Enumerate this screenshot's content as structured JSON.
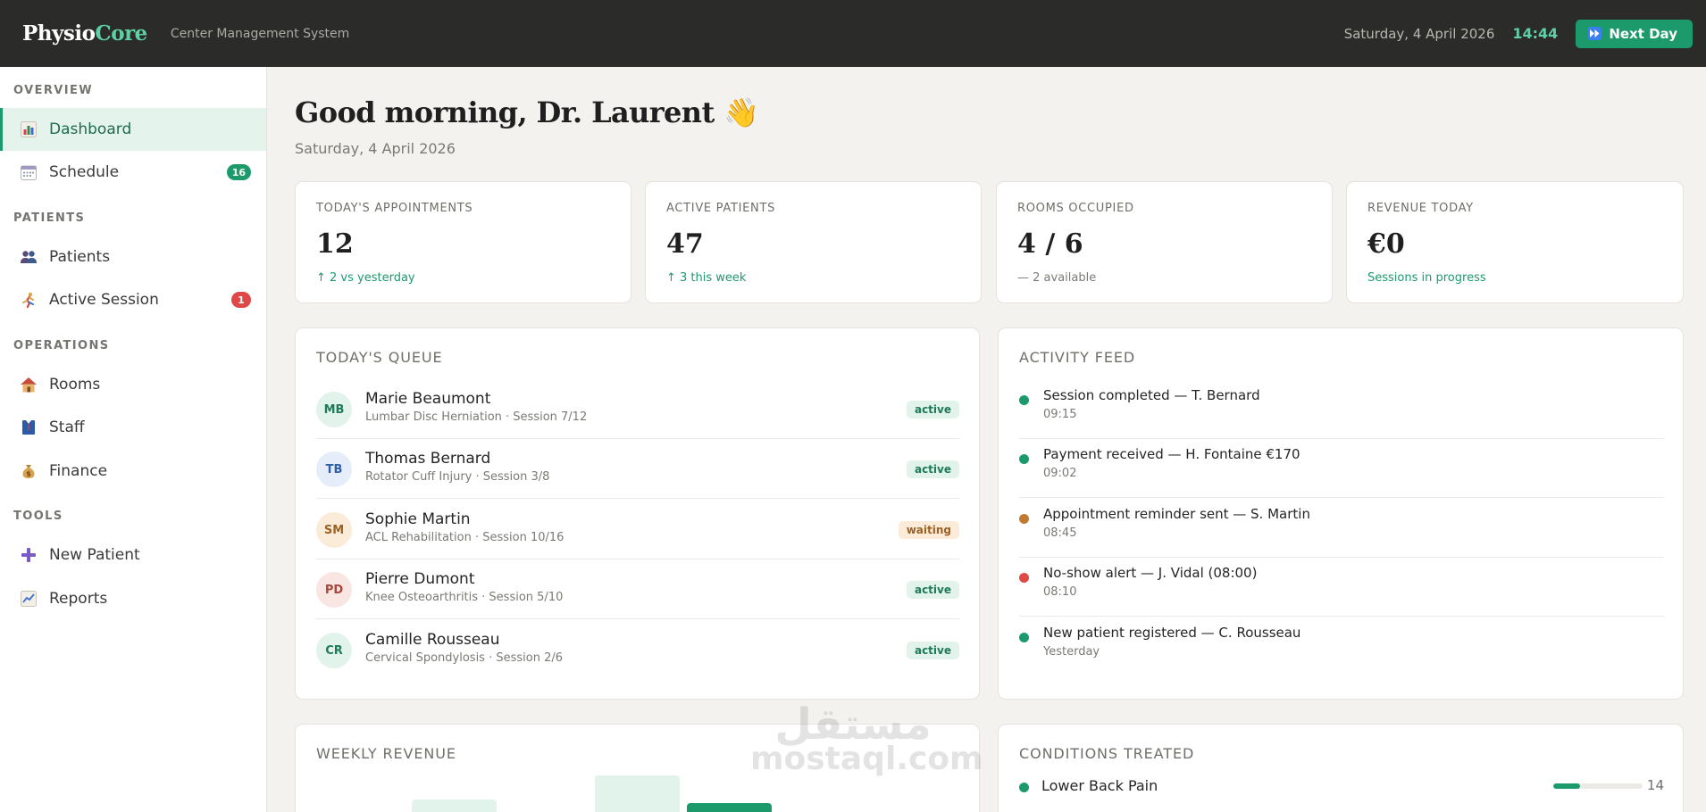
{
  "topbar": {
    "logo_main": "Physio",
    "logo_accent": "Core",
    "subtitle": "Center Management System",
    "date": "Saturday, 4 April 2026",
    "time": "14:44",
    "next_day_label": "Next Day",
    "accent_color": "#5fcfa6",
    "button_color": "#1d9a6c"
  },
  "sidebar": {
    "sections": [
      {
        "title": "OVERVIEW",
        "items": [
          {
            "label": "Dashboard",
            "icon": "bar-chart-icon",
            "active": true
          },
          {
            "label": "Schedule",
            "icon": "calendar-icon",
            "badge": "16",
            "badge_color": "#1d9a6c"
          }
        ]
      },
      {
        "title": "PATIENTS",
        "items": [
          {
            "label": "Patients",
            "icon": "people-icon"
          },
          {
            "label": "Active Session",
            "icon": "runner-icon",
            "badge": "1",
            "badge_color": "#e04848"
          }
        ]
      },
      {
        "title": "OPERATIONS",
        "items": [
          {
            "label": "Rooms",
            "icon": "house-icon"
          },
          {
            "label": "Staff",
            "icon": "person-tie-icon"
          },
          {
            "label": "Finance",
            "icon": "money-bag-icon"
          }
        ]
      },
      {
        "title": "TOOLS",
        "items": [
          {
            "label": "New Patient",
            "icon": "plus-icon"
          },
          {
            "label": "Reports",
            "icon": "line-chart-icon"
          }
        ]
      }
    ]
  },
  "main": {
    "greeting": "Good morning, Dr. Laurent 👋",
    "date": "Saturday, 4 April 2026",
    "stats": [
      {
        "label": "TODAY'S APPOINTMENTS",
        "value": "12",
        "note": "↑ 2 vs yesterday",
        "note_color": "green"
      },
      {
        "label": "ACTIVE PATIENTS",
        "value": "47",
        "note": "↑ 3 this week",
        "note_color": "green"
      },
      {
        "label": "ROOMS OCCUPIED",
        "value": "4 / 6",
        "note": "— 2 available",
        "note_color": "gray"
      },
      {
        "label": "REVENUE TODAY",
        "value": "€0",
        "note": "Sessions in progress",
        "note_color": "green"
      }
    ],
    "queue": {
      "title": "TODAY'S QUEUE",
      "rows": [
        {
          "initials": "MB",
          "name": "Marie Beaumont",
          "detail": "Lumbar Disc Herniation · Session 7/12",
          "status": "active",
          "avatar_bg": "#e2f3ec",
          "avatar_fg": "#1e7a58"
        },
        {
          "initials": "TB",
          "name": "Thomas Bernard",
          "detail": "Rotator Cuff Injury · Session 3/8",
          "status": "active",
          "avatar_bg": "#e4edf9",
          "avatar_fg": "#2f5fa8"
        },
        {
          "initials": "SM",
          "name": "Sophie Martin",
          "detail": "ACL Rehabilitation · Session 10/16",
          "status": "waiting",
          "avatar_bg": "#fbecd9",
          "avatar_fg": "#9c6224"
        },
        {
          "initials": "PD",
          "name": "Pierre Dumont",
          "detail": "Knee Osteoarthritis · Session 5/10",
          "status": "active",
          "avatar_bg": "#f9e6e3",
          "avatar_fg": "#a8473d"
        },
        {
          "initials": "CR",
          "name": "Camille Rousseau",
          "detail": "Cervical Spondylosis · Session 2/6",
          "status": "active",
          "avatar_bg": "#e2f3ec",
          "avatar_fg": "#1e7a58"
        }
      ]
    },
    "activity": {
      "title": "ACTIVITY FEED",
      "rows": [
        {
          "text": "Session completed — T. Bernard",
          "time": "09:15",
          "color": "#1d9a6c"
        },
        {
          "text": "Payment received — H. Fontaine €170",
          "time": "09:02",
          "color": "#1d9a6c"
        },
        {
          "text": "Appointment reminder sent — S. Martin",
          "time": "08:45",
          "color": "#c07a32"
        },
        {
          "text": "No-show alert — J. Vidal (08:00)",
          "time": "08:10",
          "color": "#e04848"
        },
        {
          "text": "New patient registered — C. Rousseau",
          "time": "Yesterday",
          "color": "#1d9a6c"
        }
      ]
    },
    "weekly_revenue": {
      "title": "WEEKLY REVENUE"
    },
    "conditions": {
      "title": "CONDITIONS TREATED",
      "rows": [
        {
          "name": "Lower Back Pain",
          "count": "14",
          "fraction": 0.3,
          "color": "#1d9a6c"
        }
      ]
    }
  },
  "watermark": {
    "arabic": "مستقل",
    "latin": "mostaql.com"
  }
}
